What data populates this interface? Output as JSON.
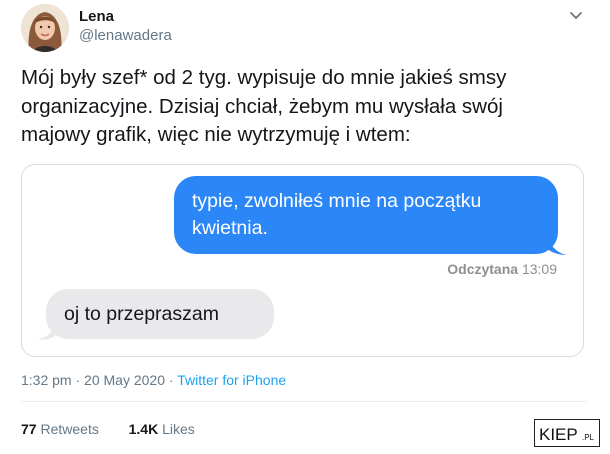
{
  "tweet": {
    "author_name": "Lena",
    "author_handle": "@lenawadera",
    "text": "Mój były szef* od 2 tyg. wypisuje do mnie jakieś smsy\norganizacyjne. Dzisiaj chciał, żebym mu wysłała swój\nmajowy grafik, więc nie wytrzymuję i wtem:",
    "time": "1:32 pm",
    "separator": "·",
    "date": "20 May 2020",
    "source": "Twitter for iPhone",
    "retweets_count": "77",
    "retweets_label": "Retweets",
    "likes_count": "1.4K",
    "likes_label": "Likes"
  },
  "media": {
    "sent_message": "typie, zwolniłeś mnie na początku kwietnia.",
    "read_label": "Odczytana",
    "read_time": "13:09",
    "received_message": "oj to przepraszam"
  },
  "watermark": {
    "text": "KIEP.PL"
  },
  "icons": {
    "more": "chevron-down-icon",
    "avatar": "avatar"
  },
  "colors": {
    "sent_bubble": "#2b86f8",
    "received_bubble": "#e9e9eb",
    "link": "#1da1f2",
    "secondary_text": "#657786"
  }
}
